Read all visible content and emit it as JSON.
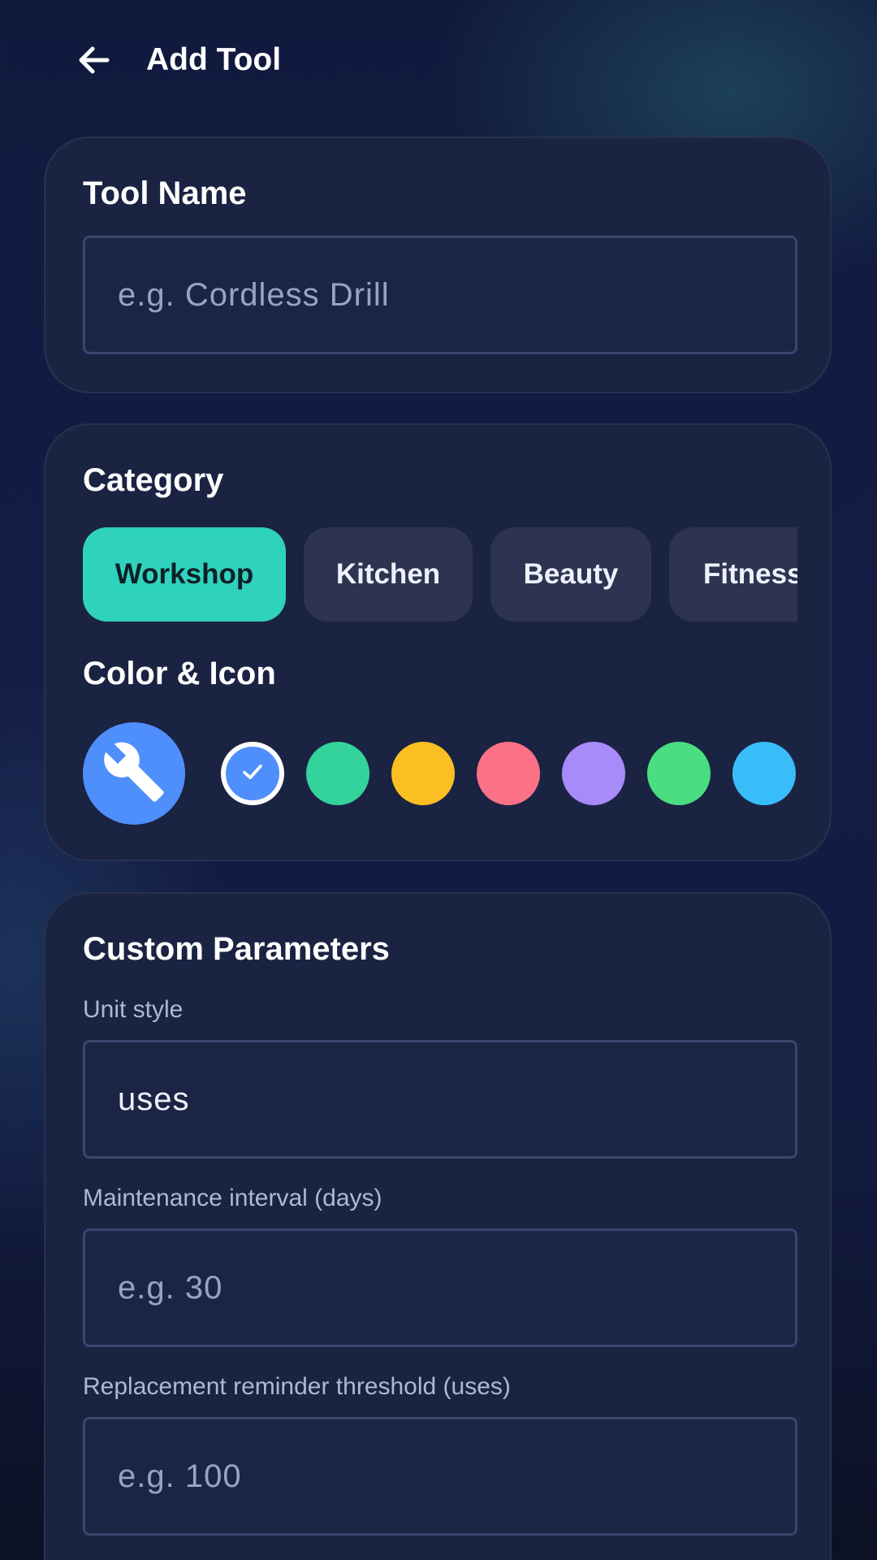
{
  "header": {
    "back_icon": "arrow-left-icon",
    "title": "Add Tool"
  },
  "tool_name": {
    "label": "Tool Name",
    "value": "",
    "placeholder": "e.g. Cordless Drill"
  },
  "category": {
    "label": "Category",
    "options": [
      "Workshop",
      "Kitchen",
      "Beauty",
      "Fitness"
    ],
    "selected": "Workshop",
    "selected_color": "#2fd3bd"
  },
  "color_icon": {
    "label": "Color & Icon",
    "preview_icon": "wrench-icon",
    "preview_color": "#4f8ffb",
    "swatches": [
      "#4f8ffb",
      "#33d39b",
      "#fbbf24",
      "#fb7185",
      "#a78bfa",
      "#4ade80",
      "#38bdf8"
    ],
    "selected_index": 0,
    "check_icon": "check-icon"
  },
  "custom_parameters": {
    "title": "Custom Parameters",
    "unit_style": {
      "label": "Unit style",
      "value": "uses",
      "placeholder": ""
    },
    "maintenance_interval": {
      "label": "Maintenance interval (days)",
      "value": "",
      "placeholder": "e.g. 30"
    },
    "replacement_threshold": {
      "label": "Replacement reminder threshold (uses)",
      "value": "",
      "placeholder": "e.g. 100"
    }
  }
}
